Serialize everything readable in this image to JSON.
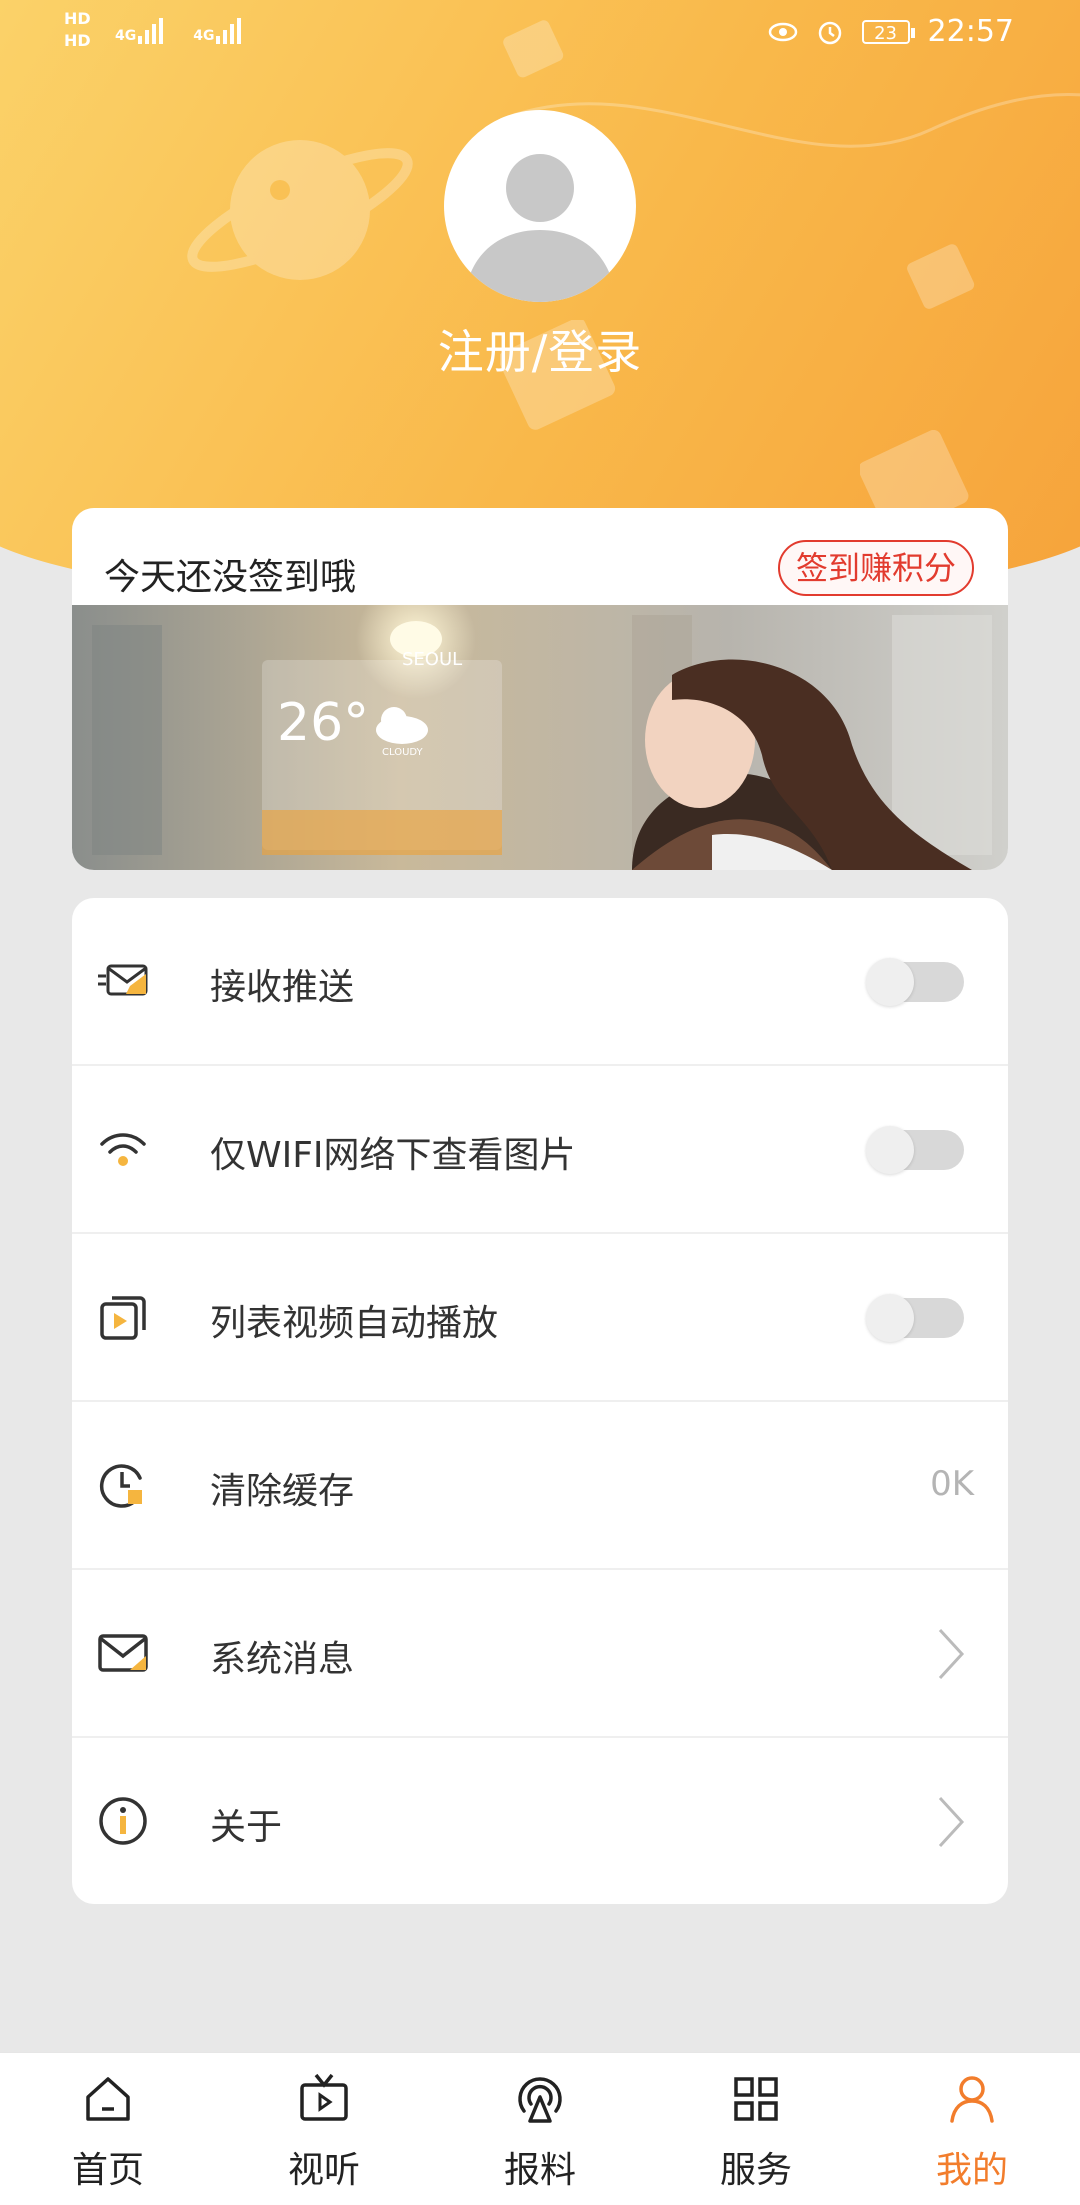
{
  "status_bar": {
    "left_labels": [
      "HD",
      "HD"
    ],
    "network": [
      "4G",
      "4G"
    ],
    "battery": "23",
    "time": "22:57"
  },
  "profile": {
    "login_text": "注册/登录"
  },
  "signin": {
    "title": "今天还没签到哦",
    "button": "签到赚积分"
  },
  "banner": {
    "city": "SEOUL",
    "temperature": "26°",
    "weather": "CLOUDY"
  },
  "settings": {
    "items": [
      {
        "label": "接收推送",
        "control": "toggle",
        "on": false,
        "icon": "push-envelope-icon"
      },
      {
        "label": "仅WIFI网络下查看图片",
        "control": "toggle",
        "on": false,
        "icon": "wifi-icon"
      },
      {
        "label": "列表视频自动播放",
        "control": "toggle",
        "on": false,
        "icon": "video-play-icon"
      },
      {
        "label": "清除缓存",
        "control": "value",
        "value": "0K",
        "icon": "clock-clear-icon"
      },
      {
        "label": "系统消息",
        "control": "chevron",
        "icon": "mail-icon"
      },
      {
        "label": "关于",
        "control": "chevron",
        "icon": "info-icon"
      }
    ]
  },
  "tabbar": {
    "tabs": [
      {
        "label": "首页",
        "icon": "home-icon",
        "active": false
      },
      {
        "label": "视听",
        "icon": "tv-icon",
        "active": false
      },
      {
        "label": "报料",
        "icon": "broadcast-icon",
        "active": false
      },
      {
        "label": "服务",
        "icon": "grid-icon",
        "active": false
      },
      {
        "label": "我的",
        "icon": "user-icon",
        "active": true
      }
    ],
    "active_color": "#f27d2c"
  },
  "colors": {
    "header_start": "#fbd36a",
    "header_end": "#f6a23a",
    "accent_red": "#e23b2e"
  }
}
